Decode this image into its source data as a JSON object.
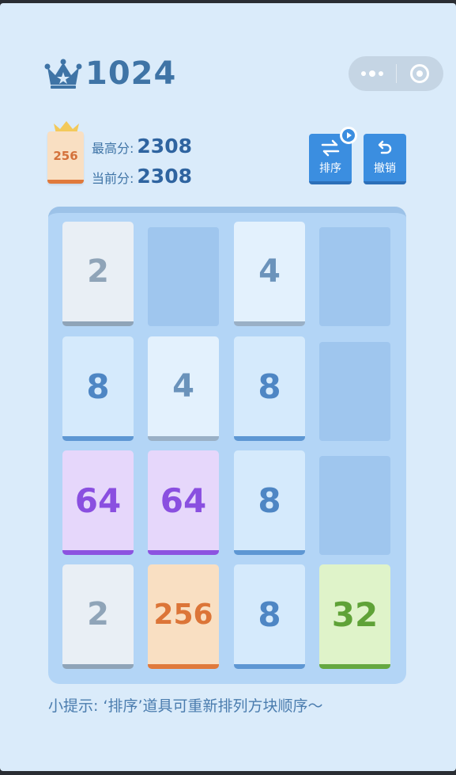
{
  "header": {
    "title": "1024",
    "crown_icon": "crown-icon",
    "menu_icon": "more-dots-icon",
    "close_icon": "target-circle-icon"
  },
  "scores": {
    "best_tile": "256",
    "best_label": "最高分:",
    "best_value": "2308",
    "current_label": "当前分:",
    "current_value": "2308"
  },
  "tools": {
    "sort_label": "排序",
    "sort_icon": "swap-arrows-icon",
    "undo_label": "撤销",
    "undo_icon": "undo-arrow-icon",
    "video_badge_icon": "video-play-icon"
  },
  "board": {
    "rows": [
      [
        "2",
        "",
        "4",
        ""
      ],
      [
        "8",
        "4",
        "8",
        ""
      ],
      [
        "64",
        "64",
        "8",
        ""
      ],
      [
        "2",
        "256",
        "8",
        "32"
      ]
    ]
  },
  "hint": "小提示: ‘排序’道具可重新排列方块顺序～",
  "colors": {
    "background": "#daebfa",
    "board": "#b3d5f6",
    "primary_button": "#3b8ee0",
    "title_text": "#3f74a6"
  }
}
